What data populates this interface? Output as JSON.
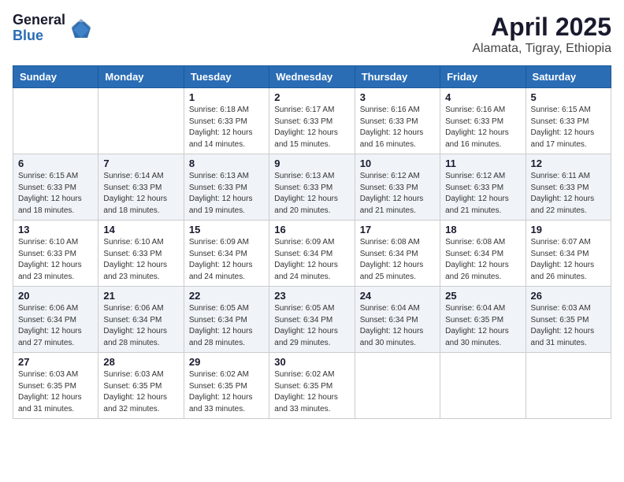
{
  "logo": {
    "general": "General",
    "blue": "Blue"
  },
  "header": {
    "month_year": "April 2025",
    "location": "Alamata, Tigray, Ethiopia"
  },
  "weekdays": [
    "Sunday",
    "Monday",
    "Tuesday",
    "Wednesday",
    "Thursday",
    "Friday",
    "Saturday"
  ],
  "weeks": [
    [
      {
        "day": "",
        "info": ""
      },
      {
        "day": "",
        "info": ""
      },
      {
        "day": "1",
        "info": "Sunrise: 6:18 AM\nSunset: 6:33 PM\nDaylight: 12 hours and 14 minutes."
      },
      {
        "day": "2",
        "info": "Sunrise: 6:17 AM\nSunset: 6:33 PM\nDaylight: 12 hours and 15 minutes."
      },
      {
        "day": "3",
        "info": "Sunrise: 6:16 AM\nSunset: 6:33 PM\nDaylight: 12 hours and 16 minutes."
      },
      {
        "day": "4",
        "info": "Sunrise: 6:16 AM\nSunset: 6:33 PM\nDaylight: 12 hours and 16 minutes."
      },
      {
        "day": "5",
        "info": "Sunrise: 6:15 AM\nSunset: 6:33 PM\nDaylight: 12 hours and 17 minutes."
      }
    ],
    [
      {
        "day": "6",
        "info": "Sunrise: 6:15 AM\nSunset: 6:33 PM\nDaylight: 12 hours and 18 minutes."
      },
      {
        "day": "7",
        "info": "Sunrise: 6:14 AM\nSunset: 6:33 PM\nDaylight: 12 hours and 18 minutes."
      },
      {
        "day": "8",
        "info": "Sunrise: 6:13 AM\nSunset: 6:33 PM\nDaylight: 12 hours and 19 minutes."
      },
      {
        "day": "9",
        "info": "Sunrise: 6:13 AM\nSunset: 6:33 PM\nDaylight: 12 hours and 20 minutes."
      },
      {
        "day": "10",
        "info": "Sunrise: 6:12 AM\nSunset: 6:33 PM\nDaylight: 12 hours and 21 minutes."
      },
      {
        "day": "11",
        "info": "Sunrise: 6:12 AM\nSunset: 6:33 PM\nDaylight: 12 hours and 21 minutes."
      },
      {
        "day": "12",
        "info": "Sunrise: 6:11 AM\nSunset: 6:33 PM\nDaylight: 12 hours and 22 minutes."
      }
    ],
    [
      {
        "day": "13",
        "info": "Sunrise: 6:10 AM\nSunset: 6:33 PM\nDaylight: 12 hours and 23 minutes."
      },
      {
        "day": "14",
        "info": "Sunrise: 6:10 AM\nSunset: 6:33 PM\nDaylight: 12 hours and 23 minutes."
      },
      {
        "day": "15",
        "info": "Sunrise: 6:09 AM\nSunset: 6:34 PM\nDaylight: 12 hours and 24 minutes."
      },
      {
        "day": "16",
        "info": "Sunrise: 6:09 AM\nSunset: 6:34 PM\nDaylight: 12 hours and 24 minutes."
      },
      {
        "day": "17",
        "info": "Sunrise: 6:08 AM\nSunset: 6:34 PM\nDaylight: 12 hours and 25 minutes."
      },
      {
        "day": "18",
        "info": "Sunrise: 6:08 AM\nSunset: 6:34 PM\nDaylight: 12 hours and 26 minutes."
      },
      {
        "day": "19",
        "info": "Sunrise: 6:07 AM\nSunset: 6:34 PM\nDaylight: 12 hours and 26 minutes."
      }
    ],
    [
      {
        "day": "20",
        "info": "Sunrise: 6:06 AM\nSunset: 6:34 PM\nDaylight: 12 hours and 27 minutes."
      },
      {
        "day": "21",
        "info": "Sunrise: 6:06 AM\nSunset: 6:34 PM\nDaylight: 12 hours and 28 minutes."
      },
      {
        "day": "22",
        "info": "Sunrise: 6:05 AM\nSunset: 6:34 PM\nDaylight: 12 hours and 28 minutes."
      },
      {
        "day": "23",
        "info": "Sunrise: 6:05 AM\nSunset: 6:34 PM\nDaylight: 12 hours and 29 minutes."
      },
      {
        "day": "24",
        "info": "Sunrise: 6:04 AM\nSunset: 6:34 PM\nDaylight: 12 hours and 30 minutes."
      },
      {
        "day": "25",
        "info": "Sunrise: 6:04 AM\nSunset: 6:35 PM\nDaylight: 12 hours and 30 minutes."
      },
      {
        "day": "26",
        "info": "Sunrise: 6:03 AM\nSunset: 6:35 PM\nDaylight: 12 hours and 31 minutes."
      }
    ],
    [
      {
        "day": "27",
        "info": "Sunrise: 6:03 AM\nSunset: 6:35 PM\nDaylight: 12 hours and 31 minutes."
      },
      {
        "day": "28",
        "info": "Sunrise: 6:03 AM\nSunset: 6:35 PM\nDaylight: 12 hours and 32 minutes."
      },
      {
        "day": "29",
        "info": "Sunrise: 6:02 AM\nSunset: 6:35 PM\nDaylight: 12 hours and 33 minutes."
      },
      {
        "day": "30",
        "info": "Sunrise: 6:02 AM\nSunset: 6:35 PM\nDaylight: 12 hours and 33 minutes."
      },
      {
        "day": "",
        "info": ""
      },
      {
        "day": "",
        "info": ""
      },
      {
        "day": "",
        "info": ""
      }
    ]
  ]
}
